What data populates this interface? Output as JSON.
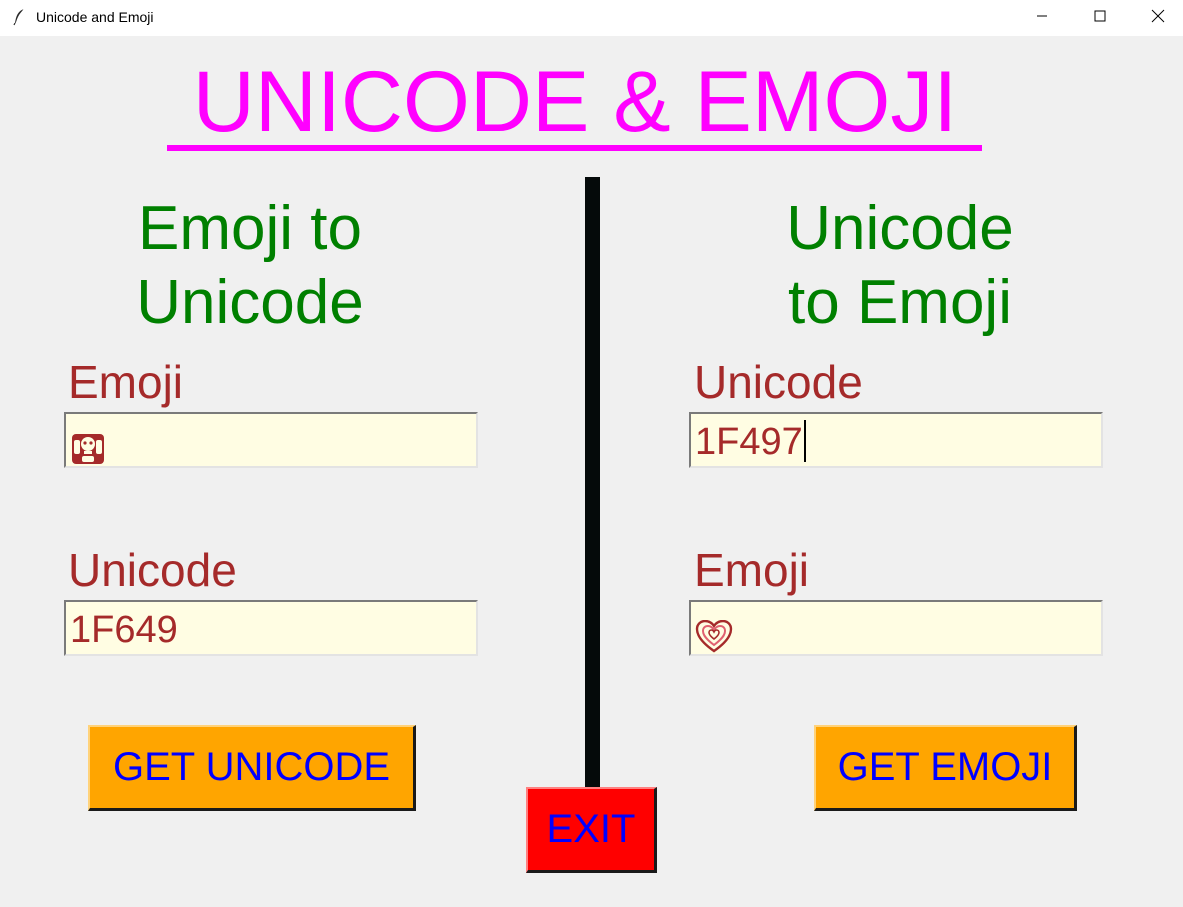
{
  "window": {
    "title": "Unicode and Emoji",
    "app_icon": "feather-icon",
    "minimize_icon": "minimize-icon",
    "maximize_icon": "maximize-icon",
    "close_icon": "close-icon"
  },
  "heading": "UNICODE & EMOJI",
  "left_panel": {
    "title_line1": "Emoji to",
    "title_line2": "Unicode",
    "emoji_label": "Emoji",
    "emoji_value": "🙉",
    "unicode_label": "Unicode",
    "unicode_value": "1F649",
    "button_label": "GET UNICODE"
  },
  "right_panel": {
    "title_line1": "Unicode",
    "title_line2": "to Emoji",
    "unicode_label": "Unicode",
    "unicode_value": "1F497",
    "emoji_label": "Emoji",
    "emoji_value": "💗",
    "button_label": "GET EMOJI"
  },
  "exit_label": "EXIT",
  "colors": {
    "background": "#f0f0f0",
    "heading": "#ff00ff",
    "section_title": "#008000",
    "field_label": "#a52a2a",
    "entry_background": "#fffde3",
    "button_background": "#ffa500",
    "button_text": "#0000ff",
    "exit_background": "#ff0000",
    "divider": "#050a0a"
  }
}
